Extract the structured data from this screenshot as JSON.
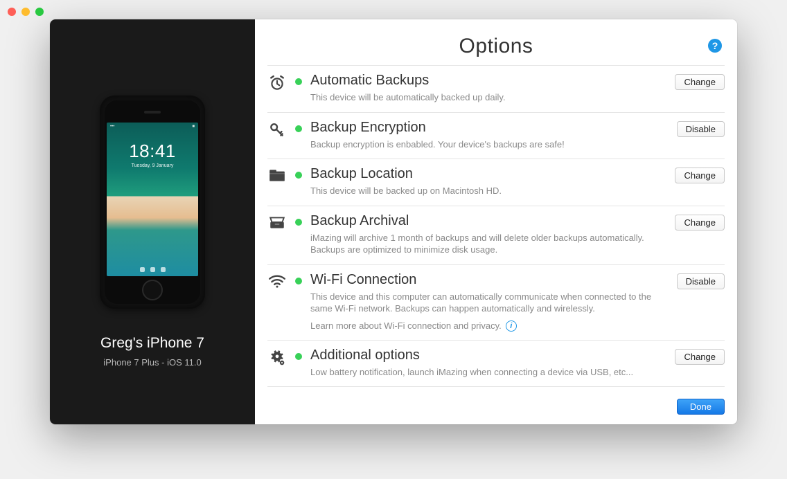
{
  "page": {
    "title": "Options"
  },
  "device": {
    "name": "Greg's iPhone 7",
    "info": "iPhone 7 Plus - iOS 11.0",
    "clock": "18:41",
    "date": "Tuesday, 9 January"
  },
  "options": {
    "backups": {
      "title": "Automatic Backups",
      "desc": "This device will be automatically backed up daily.",
      "action": "Change"
    },
    "encrypt": {
      "title": "Backup Encryption",
      "desc": "Backup encryption is enbabled. Your device's backups are safe!",
      "action": "Disable"
    },
    "location": {
      "title": "Backup Location",
      "desc": "This device will be backed up on Macintosh HD.",
      "action": "Change"
    },
    "archival": {
      "title": "Backup Archival",
      "desc": "iMazing will archive 1 month of backups and will delete older backups automatically. Backups are optimized to minimize disk usage.",
      "action": "Change"
    },
    "wifi": {
      "title": "Wi-Fi Connection",
      "desc": "This device and this computer can automatically communicate when connected to the same Wi-Fi network. Backups can happen automatically and wirelessly.",
      "learn": "Learn more about Wi-Fi connection and privacy.",
      "action": "Disable"
    },
    "addl": {
      "title": "Additional options",
      "desc": "Low battery notification, launch iMazing when connecting a device via USB, etc...",
      "action": "Change"
    }
  },
  "footer": {
    "done": "Done"
  }
}
